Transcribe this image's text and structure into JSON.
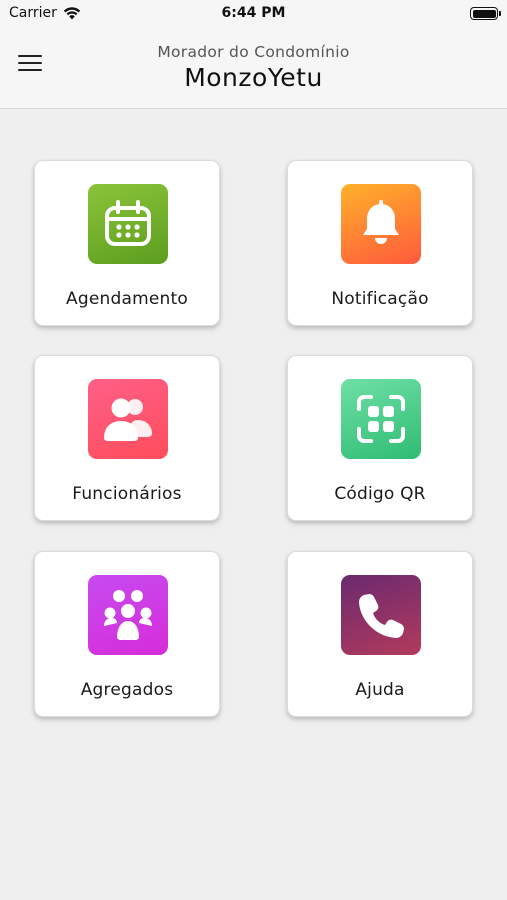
{
  "status_bar": {
    "carrier": "Carrier",
    "time": "6:44 PM",
    "icons": [
      "wifi-icon",
      "battery-icon"
    ]
  },
  "header": {
    "menu_icon": "hamburger-menu-icon",
    "subtitle": "Morador do Condomínio",
    "title": "MonzoYetu"
  },
  "menu_cards": [
    {
      "label": "Agendamento",
      "icon": "calendar-icon",
      "colors": [
        "#8bc43a",
        "#5c9d1f"
      ]
    },
    {
      "label": "Notificação",
      "icon": "bell-icon",
      "colors": [
        "#ffb12a",
        "#ff5a3c"
      ]
    },
    {
      "label": "Funcionários",
      "icon": "users-icon",
      "colors": [
        "#ff5f88",
        "#ff4d5b"
      ]
    },
    {
      "label": "Código QR",
      "icon": "qr-scan-icon",
      "colors": [
        "#6fe0a6",
        "#2fbc73"
      ]
    },
    {
      "label": "Agregados",
      "icon": "group-icon",
      "colors": [
        "#c64bf0",
        "#d62cd8"
      ]
    },
    {
      "label": "Ajuda",
      "icon": "phone-icon",
      "colors": [
        "#6a2a6f",
        "#b23a5c"
      ]
    }
  ]
}
